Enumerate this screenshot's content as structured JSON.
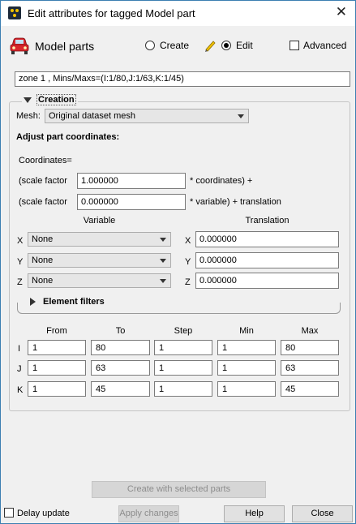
{
  "window": {
    "title": "Edit attributes for tagged Model part"
  },
  "header": {
    "label": "Model parts",
    "create_label": "Create",
    "edit_label": "Edit",
    "mode_selected": "Edit",
    "advanced_label": "Advanced",
    "advanced_checked": false
  },
  "info_text": "zone 1 , Mins/Maxs=(I:1/80,J:1/63,K:1/45)",
  "creation": {
    "label": "Creation",
    "mesh_label": "Mesh:",
    "mesh_value": "Original dataset mesh",
    "adjust_heading": "Adjust part coordinates:",
    "coordinates_label": "Coordinates=",
    "scale1_prefix": "(scale factor",
    "scale1_value": "1.000000",
    "scale1_suffix": "* coordinates) +",
    "scale2_prefix": "(scale factor",
    "scale2_value": "0.000000",
    "scale2_suffix": "* variable) + translation",
    "variable_header": "Variable",
    "translation_header": "Translation",
    "rows": [
      {
        "axis": "X",
        "variable": "None",
        "translation_axis": "X",
        "translation": "0.000000"
      },
      {
        "axis": "Y",
        "variable": "None",
        "translation_axis": "Y",
        "translation": "0.000000"
      },
      {
        "axis": "Z",
        "variable": "None",
        "translation_axis": "Z",
        "translation": "0.000000"
      }
    ],
    "element_filters_label": "Element filters",
    "table": {
      "headers": [
        "From",
        "To",
        "Step",
        "Min",
        "Max"
      ],
      "rows": [
        {
          "label": "I",
          "values": [
            "1",
            "80",
            "1",
            "1",
            "80"
          ]
        },
        {
          "label": "J",
          "values": [
            "1",
            "63",
            "1",
            "1",
            "63"
          ]
        },
        {
          "label": "K",
          "values": [
            "1",
            "45",
            "1",
            "1",
            "45"
          ]
        }
      ]
    }
  },
  "footer": {
    "create_selected_label": "Create with selected parts",
    "delay_update_label": "Delay update",
    "delay_update_checked": false,
    "apply_label": "Apply changes",
    "help_label": "Help",
    "close_label": "Close"
  },
  "colors": {
    "window_border": "#3c7fb1",
    "background": "#f0f0f0",
    "car_icon": "#d9262b"
  }
}
